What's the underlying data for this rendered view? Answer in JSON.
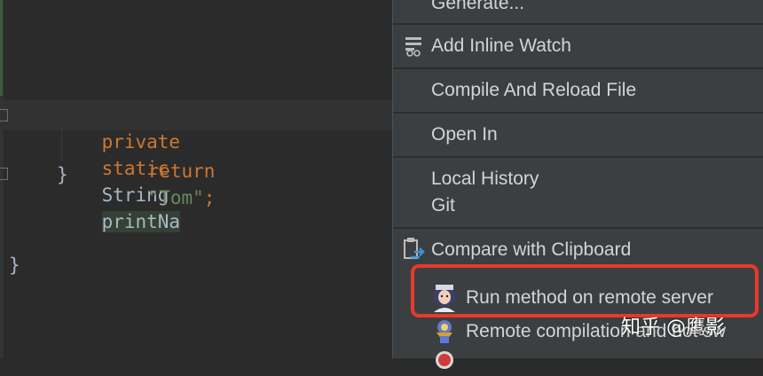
{
  "editor": {
    "line1": {
      "kw1": "private",
      "kw2": "static",
      "type": "String",
      "method": "printNa"
    },
    "line2": {
      "kw": "return",
      "str": "\"Tom\"",
      "semi": ";"
    },
    "line3": "}",
    "line4": "}"
  },
  "menu": {
    "items": [
      {
        "label": "Generate...",
        "icon": null
      },
      {
        "label": "Add Inline Watch",
        "icon": "inline-watch-icon"
      },
      {
        "label": "Compile And Reload File",
        "icon": null
      },
      {
        "label": "Open In",
        "icon": null
      },
      {
        "label": "Local History",
        "icon": null
      },
      {
        "label": "Git",
        "icon": null
      },
      {
        "label": "Compare with Clipboard",
        "icon": "compare-clipboard-icon"
      },
      {
        "label": "Run method on remote server",
        "icon": "arthas-avatar-icon"
      },
      {
        "label": "Remote compilation and hot sw",
        "icon": "arthas-medal-icon"
      },
      {
        "label": "",
        "icon": "red-plugin-icon"
      }
    ]
  },
  "watermark": "知乎 @鹰影",
  "colors": {
    "editor_bg": "#2b2b2b",
    "menu_bg": "#3c3f41",
    "keyword": "#cc7832",
    "string": "#6a8759",
    "highlight_border": "#e8392a"
  }
}
